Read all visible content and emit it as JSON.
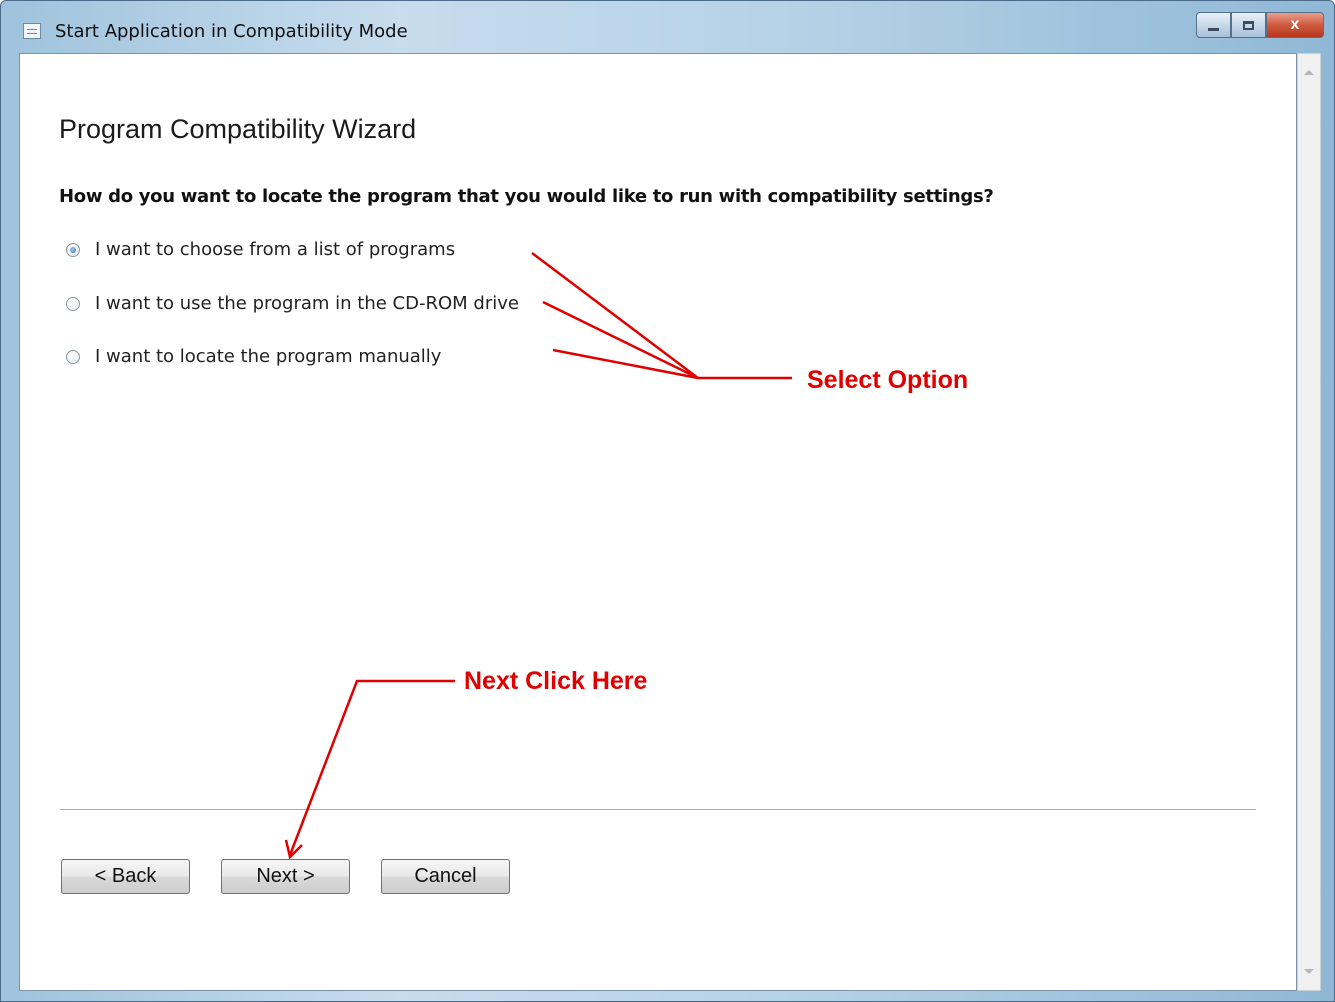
{
  "window": {
    "title": "Start Application in Compatibility Mode",
    "caption_buttons": {
      "minimize": "",
      "maximize": "",
      "close": "x"
    }
  },
  "wizard": {
    "title": "Program Compatibility Wizard",
    "question": "How do you want to locate the program that you would like to run with compatibility settings?",
    "options": [
      {
        "label": "I want to choose from a list of programs",
        "checked": true
      },
      {
        "label": "I want to use the program in the CD-ROM drive",
        "checked": false
      },
      {
        "label": "I want to locate the program manually",
        "checked": false
      }
    ]
  },
  "buttons": {
    "back": "< Back",
    "next": "Next >",
    "cancel": "Cancel"
  },
  "annotations": {
    "select_option": "Select Option",
    "next_click": "Next Click Here",
    "color": "#e00000"
  }
}
